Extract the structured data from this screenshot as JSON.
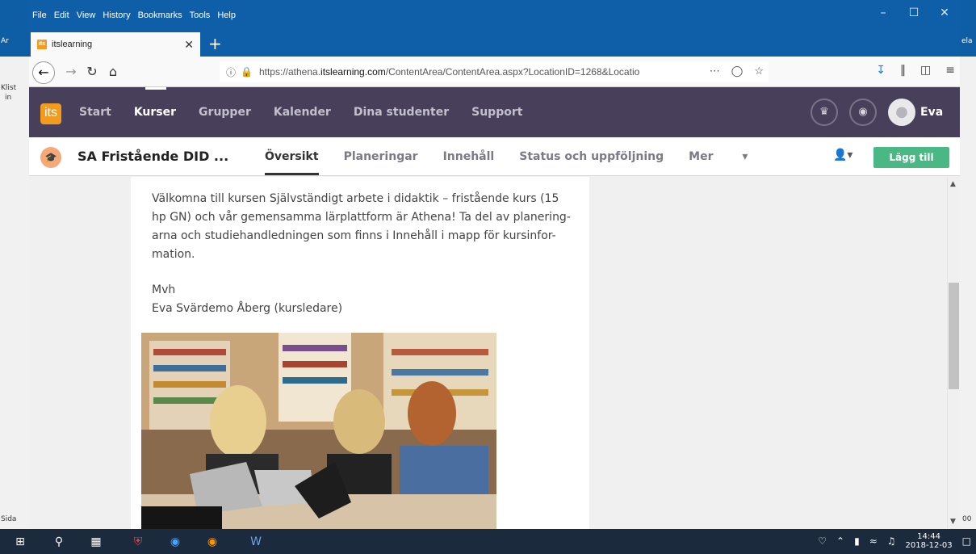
{
  "background": {
    "left_labels": [
      "Ar",
      "Klist",
      "in",
      "Sida"
    ],
    "right_labels": [
      "ela",
      "00"
    ]
  },
  "menubar": {
    "items": [
      "File",
      "Edit",
      "View",
      "History",
      "Bookmarks",
      "Tools",
      "Help"
    ]
  },
  "tab": {
    "title": "itslearning",
    "favicon": "its"
  },
  "navbar": {
    "url_prefix": "https://athena.",
    "url_domain": "itslearning.com",
    "url_rest": "/ContentArea/ContentArea.aspx?LocationID=1268&Locatio"
  },
  "its": {
    "logo": "its",
    "nav": [
      "Start",
      "Kurser",
      "Grupper",
      "Kalender",
      "Dina studenter",
      "Support"
    ],
    "active_nav": "Kurser",
    "user_name": "Eva"
  },
  "course": {
    "title": "SA Fristående DID ...",
    "tabs": [
      "Översikt",
      "Planeringar",
      "Innehåll",
      "Status och uppföljning",
      "Mer"
    ],
    "active_tab": "Översikt",
    "add_button": "Lägg till"
  },
  "content": {
    "paragraph1_lines": [
      "Välkomna till kursen Självständigt arbete i didaktik – fristående kurs (15",
      "hp GN) och vår gemensamma lärplattform är Athena! Ta del av planering-",
      "arna och studiehandledningen som finns i Innehåll i mapp för kursinfor-",
      "mation."
    ],
    "signoff": "Mvh",
    "signature": "Eva Svärdemo Åberg (kursledare)"
  },
  "taskbar": {
    "time": "14:44",
    "date": "2018-12-03"
  }
}
